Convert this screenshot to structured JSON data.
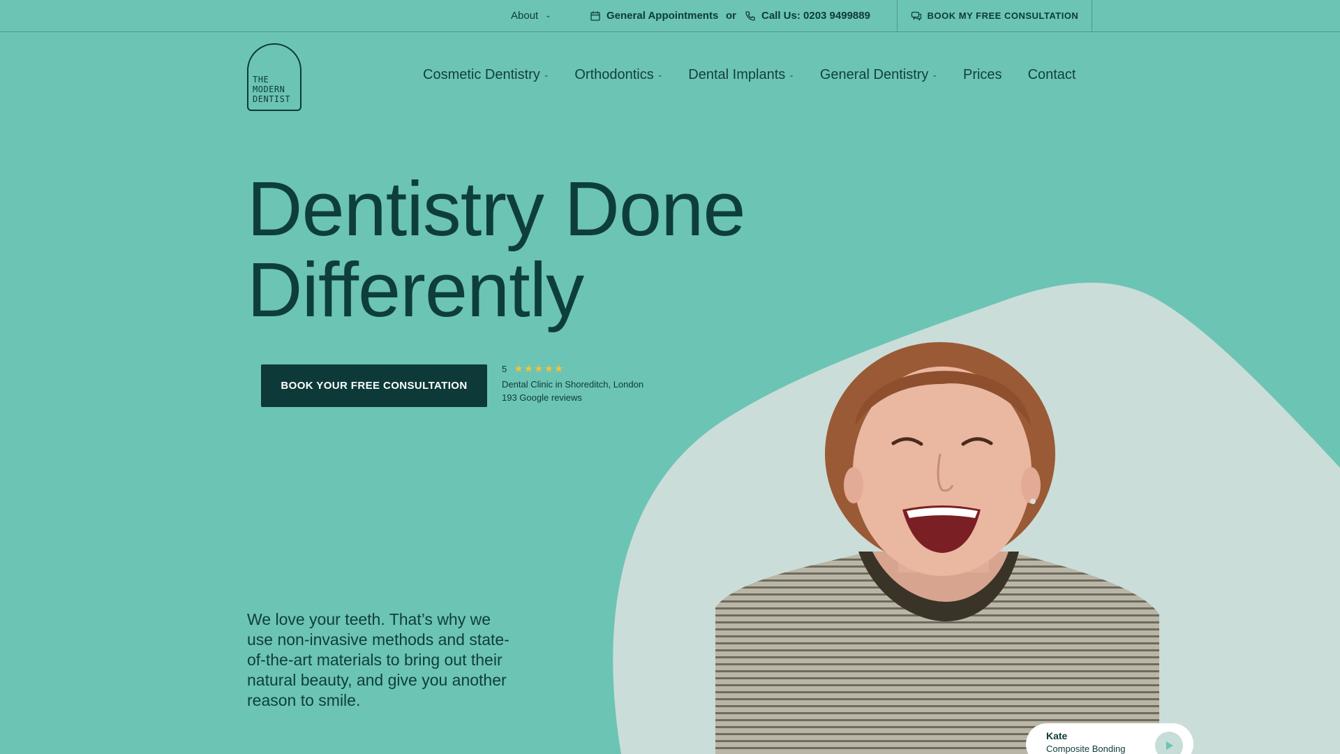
{
  "topbar": {
    "about_label": "About",
    "appointments_label": "General Appointments",
    "or_label": "or",
    "call_label": "Call Us: 0203 9499889",
    "book_label": "BOOK MY FREE CONSULTATION"
  },
  "logo": {
    "line1": "THE",
    "line2": "MODERN",
    "line3": "DENTIST"
  },
  "nav": {
    "items": [
      {
        "label": "Cosmetic Dentistry",
        "dropdown": true
      },
      {
        "label": "Orthodontics",
        "dropdown": true
      },
      {
        "label": "Dental Implants",
        "dropdown": true
      },
      {
        "label": "General Dentistry",
        "dropdown": true
      },
      {
        "label": "Prices",
        "dropdown": false
      },
      {
        "label": "Contact",
        "dropdown": false
      }
    ]
  },
  "hero": {
    "title_line1": "Dentistry Done",
    "title_line2": "Differently",
    "cta_label": "BOOK YOUR FREE CONSULTATION",
    "rating_value": "5",
    "rating_stars": 5,
    "rating_location": "Dental Clinic in Shoreditch, London",
    "rating_reviews": "193 Google reviews",
    "intro": "We love your teeth. That’s why we use non-invasive methods and state-of-the-art materials to bring out their natural beauty, and give you another reason to smile."
  },
  "testimonial": {
    "name": "Kate",
    "treatment": "Composite Bonding"
  },
  "colors": {
    "background": "#6cc4b4",
    "dark": "#0d3a38",
    "blob": "#cbddd9",
    "star": "#f2c13a"
  }
}
